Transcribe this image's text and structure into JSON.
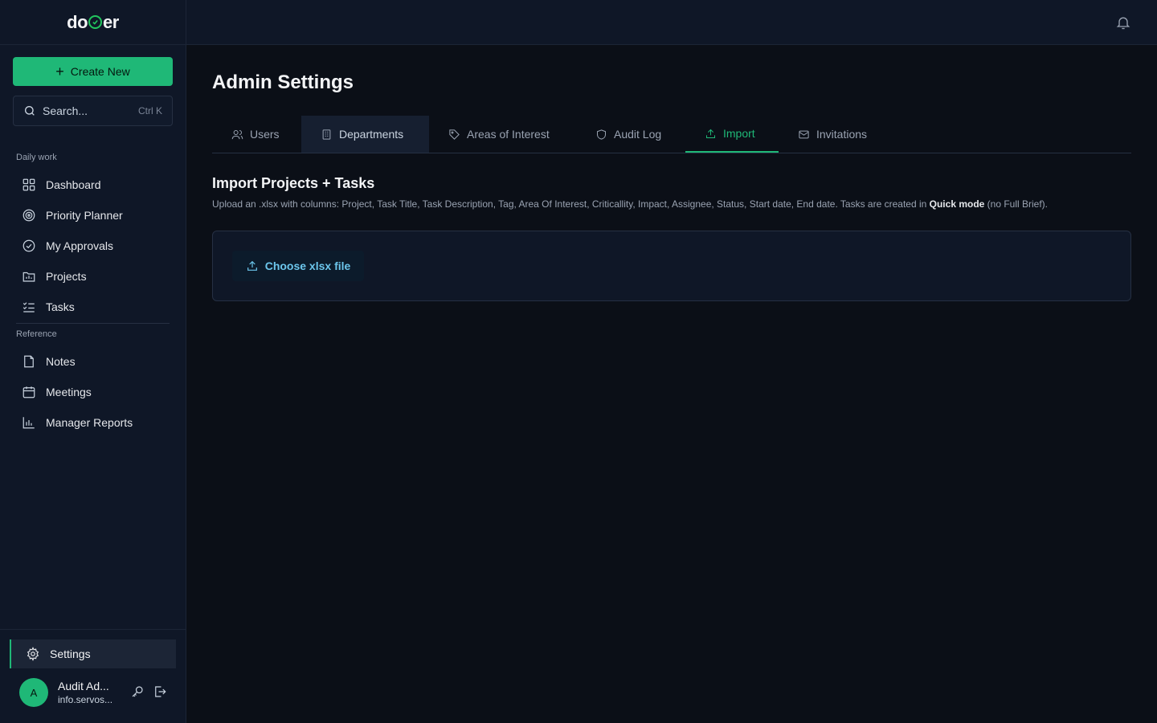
{
  "app": {
    "logo_left": "do",
    "logo_right": "er"
  },
  "sidebar": {
    "create_label": "Create New",
    "search": {
      "placeholder": "Search...",
      "shortcut": "Ctrl K"
    },
    "sections": [
      {
        "label": "Daily work",
        "items": [
          {
            "label": "Dashboard",
            "icon": "dashboard-icon"
          },
          {
            "label": "Priority Planner",
            "icon": "target-icon"
          },
          {
            "label": "My Approvals",
            "icon": "check-circle-icon"
          },
          {
            "label": "Projects",
            "icon": "folder-icon"
          },
          {
            "label": "Tasks",
            "icon": "list-check-icon"
          }
        ]
      },
      {
        "label": "Reference",
        "items": [
          {
            "label": "Notes",
            "icon": "note-icon"
          },
          {
            "label": "Meetings",
            "icon": "calendar-icon"
          },
          {
            "label": "Manager Reports",
            "icon": "bar-chart-icon"
          }
        ]
      }
    ],
    "settings_label": "Settings",
    "user": {
      "initial": "A",
      "name": "Audit Ad...",
      "email": "info.servos..."
    }
  },
  "main": {
    "title": "Admin Settings",
    "tabs": [
      {
        "label": "Users",
        "icon": "users-icon"
      },
      {
        "label": "Departments",
        "icon": "building-icon"
      },
      {
        "label": "Areas of Interest",
        "icon": "tag-icon"
      },
      {
        "label": "Audit Log",
        "icon": "shield-icon"
      },
      {
        "label": "Import",
        "icon": "upload-icon",
        "active": true
      },
      {
        "label": "Invitations",
        "icon": "mail-icon"
      }
    ],
    "import": {
      "title": "Import Projects + Tasks",
      "desc_prefix": "Upload an .xlsx with columns: Project, Task Title, Task Description, Tag, Area Of Interest, Criticallity, Impact, Assignee, Status, Start date, End date. Tasks are created in ",
      "desc_bold": "Quick mode",
      "desc_suffix": " (no Full Brief).",
      "button_label": "Choose xlsx file"
    }
  },
  "colors": {
    "accent": "#1fb877",
    "link": "#6cc6ec",
    "bg": "#0b0f17",
    "sidebar_bg": "#0f1727"
  }
}
